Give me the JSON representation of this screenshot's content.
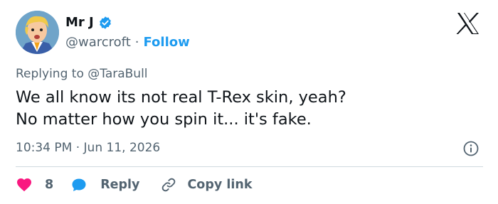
{
  "user": {
    "display_name": "Mr J",
    "handle": "@warcroft",
    "separator": "·",
    "follow_label": "Follow"
  },
  "reply_context": {
    "prefix": "Replying to",
    "mention": "@TaraBull"
  },
  "tweet": {
    "line1": "We all know its not real T-Rex skin, yeah?",
    "line2": "No matter how you spin it... it's fake."
  },
  "meta": {
    "time": "10:34 PM",
    "separator": "·",
    "date": "Jun 11, 2026"
  },
  "actions": {
    "like_count": "8",
    "reply_label": "Reply",
    "copy_link_label": "Copy link"
  },
  "colors": {
    "accent": "#1d9bf0",
    "like": "#f91880",
    "text": "#0f1419",
    "muted": "#536471"
  },
  "icons": [
    "avatar",
    "verified-badge-icon",
    "x-logo-icon",
    "info-icon",
    "heart-icon",
    "reply-bubble-icon",
    "link-icon"
  ]
}
